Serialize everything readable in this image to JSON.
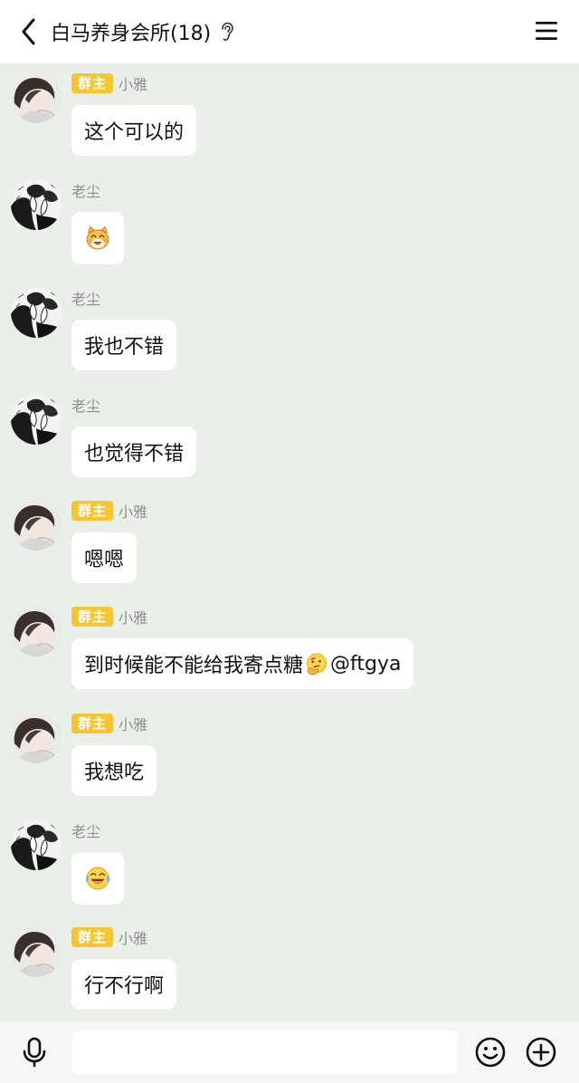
{
  "header": {
    "title": "白马养身会所(18)",
    "back_icon": "chevron-left-icon",
    "ear_icon": "ear-icon",
    "menu_icon": "hamburger-menu-icon"
  },
  "labels": {
    "owner_badge": "群主"
  },
  "messages": [
    {
      "sender": "小雅",
      "badge": "群主",
      "avatar": "girl-avatar",
      "text": "这个可以的"
    },
    {
      "sender": "老尘",
      "avatar": "manga-avatar",
      "emoji": "smiling-cat-emoji"
    },
    {
      "sender": "老尘",
      "avatar": "manga-avatar",
      "text": "我也不错"
    },
    {
      "sender": "老尘",
      "avatar": "manga-avatar",
      "text": "也觉得不错"
    },
    {
      "sender": "小雅",
      "badge": "群主",
      "avatar": "girl-avatar",
      "text": "嗯嗯"
    },
    {
      "sender": "小雅",
      "badge": "群主",
      "avatar": "girl-avatar",
      "text_before": "到时候能不能给我寄点糖",
      "inline_emoji": "thinking-face-emoji",
      "text_after": "@ftgya"
    },
    {
      "sender": "小雅",
      "badge": "群主",
      "avatar": "girl-avatar",
      "text": "我想吃"
    },
    {
      "sender": "老尘",
      "avatar": "manga-avatar",
      "emoji": "tears-of-joy-emoji"
    },
    {
      "sender": "小雅",
      "badge": "群主",
      "avatar": "girl-avatar",
      "text": "行不行啊"
    }
  ],
  "composer": {
    "value": "",
    "placeholder": "",
    "mic_icon": "microphone-icon",
    "emoji_icon": "smiley-face-icon",
    "plus_icon": "plus-circle-icon"
  },
  "colors": {
    "chat_background": "#eaefe9",
    "bubble": "#ffffff",
    "badge": "#f7c52f",
    "sender_name": "#8e8e8e"
  }
}
